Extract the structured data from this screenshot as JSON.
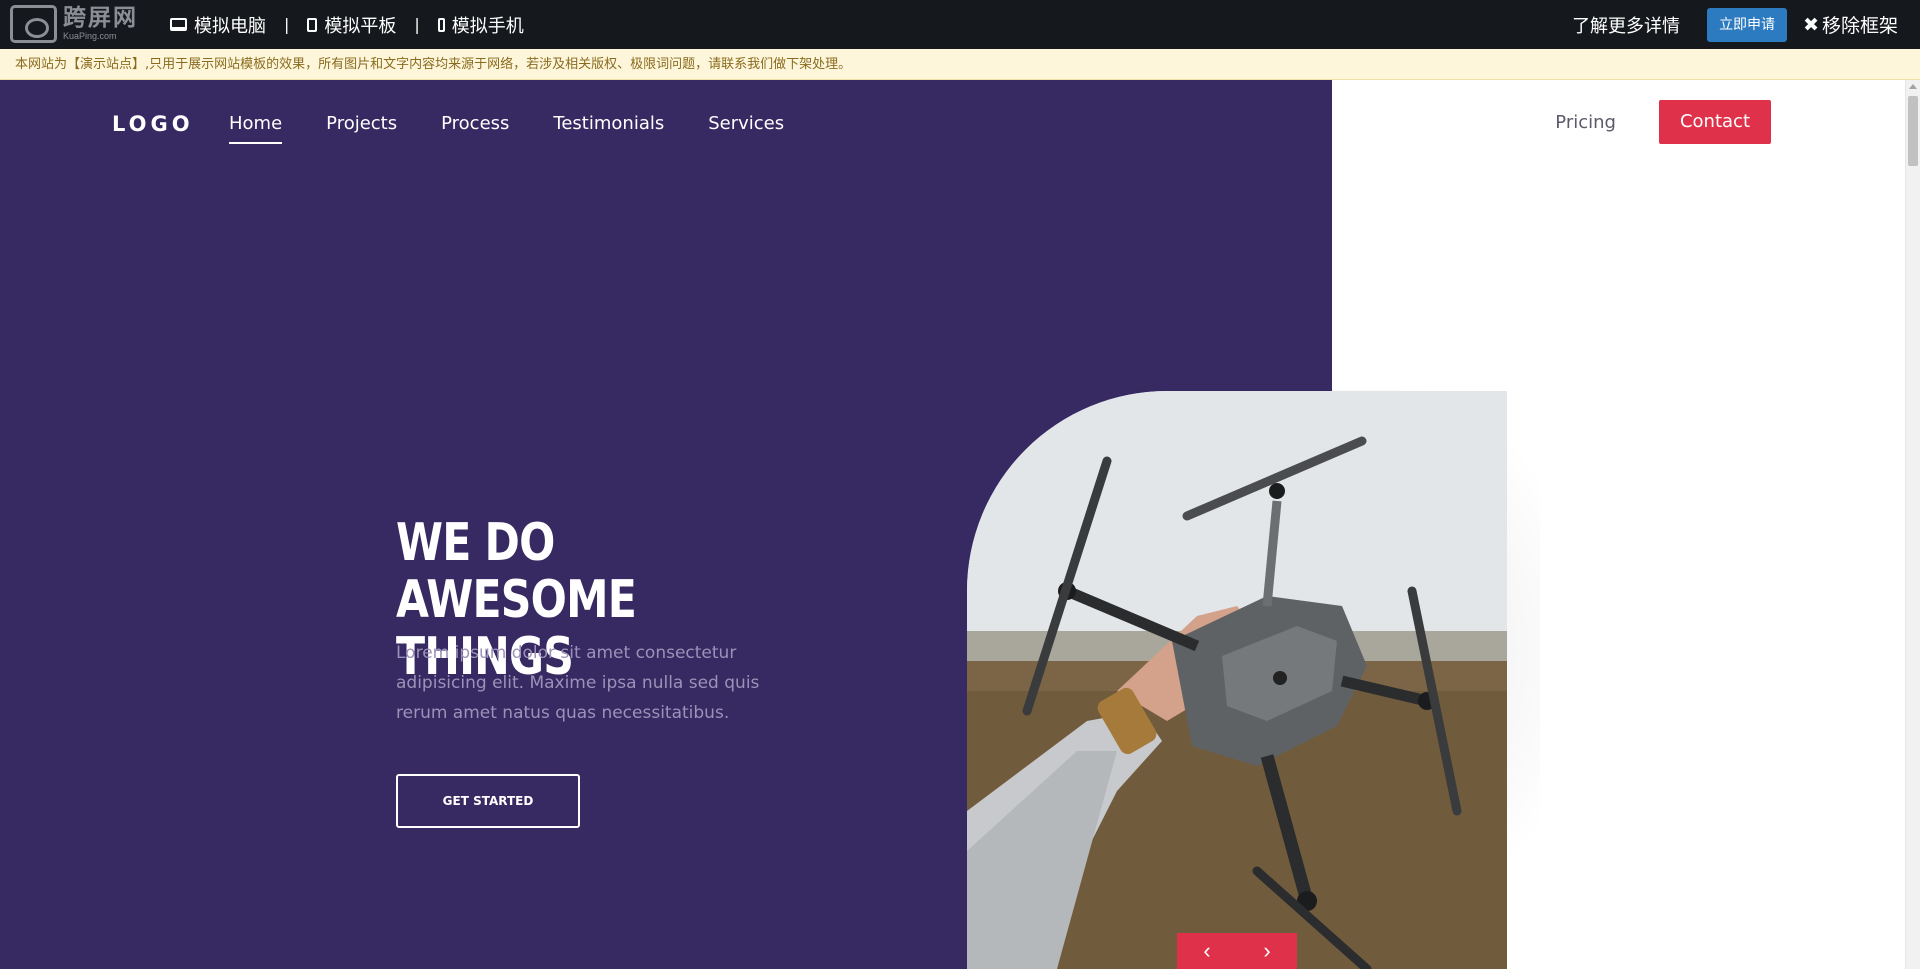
{
  "frame": {
    "logo_zh": "跨屏网",
    "logo_en": "KuaPing.com",
    "devices": [
      {
        "label": "模拟电脑",
        "icon": "desktop-icon"
      },
      {
        "label": "模拟平板",
        "icon": "tablet-icon"
      },
      {
        "label": "模拟手机",
        "icon": "phone-icon"
      }
    ],
    "separator": "|",
    "learn_more": "了解更多详情",
    "apply_label": "立即申请",
    "remove_label": "移除框架",
    "remove_icon_glyph": "✖"
  },
  "notice": {
    "text": "本网站为【演示站点】,只用于展示网站模板的效果，所有图片和文字内容均来源于网络，若涉及相关版权、极限词问题，请联系我们做下架处理。"
  },
  "site": {
    "brand": "LOGO",
    "nav": [
      {
        "label": "Home",
        "active": true
      },
      {
        "label": "Projects"
      },
      {
        "label": "Process"
      },
      {
        "label": "Testimonials"
      },
      {
        "label": "Services"
      }
    ],
    "pricing": "Pricing",
    "contact": "Contact",
    "hero": {
      "title": "WE DO AWESOME THINGS",
      "text": "Lorem ipsum dolor sit amet consectetur adipisicing elit. Maxime ipsa nulla sed quis rerum amet natus quas necessitatibus.",
      "cta": "GET STARTED"
    },
    "photo_subject": "hand holding a drone",
    "slider": {
      "prev": "‹",
      "next": "›"
    }
  },
  "colors": {
    "purple": "#372962",
    "accent": "#e0314b",
    "frame_bar": "#15181d",
    "apply_blue": "#2c7bc0",
    "notice_bg": "#fdf6da"
  }
}
